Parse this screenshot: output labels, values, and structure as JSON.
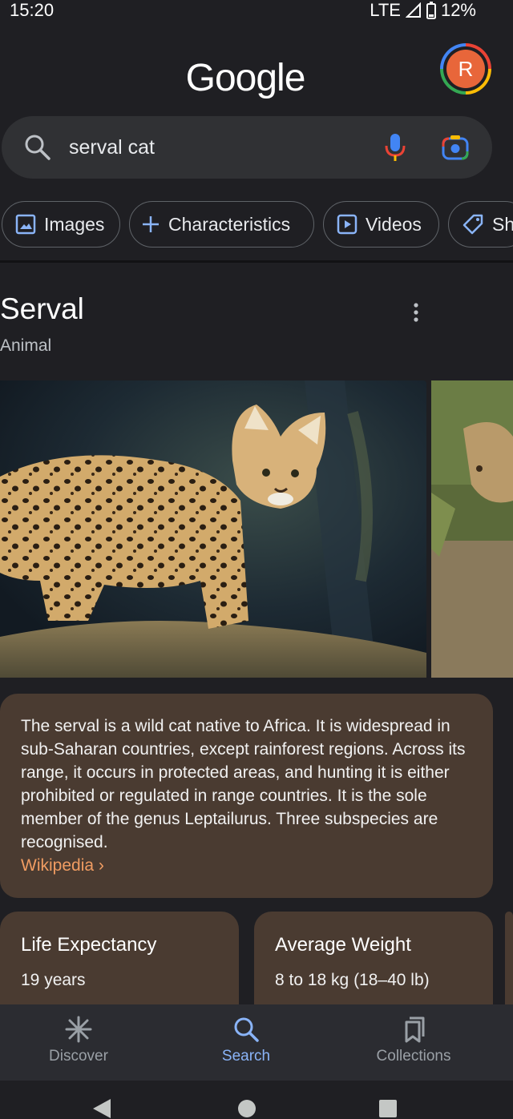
{
  "status": {
    "time": "15:20",
    "network": "LTE",
    "battery": "12%"
  },
  "header": {
    "logo": "Google",
    "avatar_initial": "R"
  },
  "search": {
    "query": "serval cat"
  },
  "chips": [
    "Images",
    "Characteristics",
    "Videos",
    "Sh"
  ],
  "knowledge_panel": {
    "title": "Serval",
    "subtitle": "Animal",
    "description": "The serval is a wild cat native to Africa. It is widespread in sub-Saharan countries, except rainforest regions. Across its range, it occurs in protected areas, and hunting it is either prohibited or regulated in range countries. It is the sole member of the genus Leptailurus. Three subspecies are recognised.",
    "source": "Wikipedia ›",
    "facts": [
      {
        "title": "Life Expectancy",
        "value": "19 years"
      },
      {
        "title": "Average Weight",
        "value": "8 to 18 kg (18–40 lb)"
      }
    ]
  },
  "bottom_nav": [
    {
      "label": "Discover",
      "icon": "asterisk-icon"
    },
    {
      "label": "Search",
      "icon": "search-icon",
      "active": true
    },
    {
      "label": "Collections",
      "icon": "bookmarks-icon"
    }
  ],
  "colors": {
    "background": "#1f1f23",
    "card": "#4a3b31",
    "link": "#f09c62",
    "active": "#8ab4f8"
  }
}
